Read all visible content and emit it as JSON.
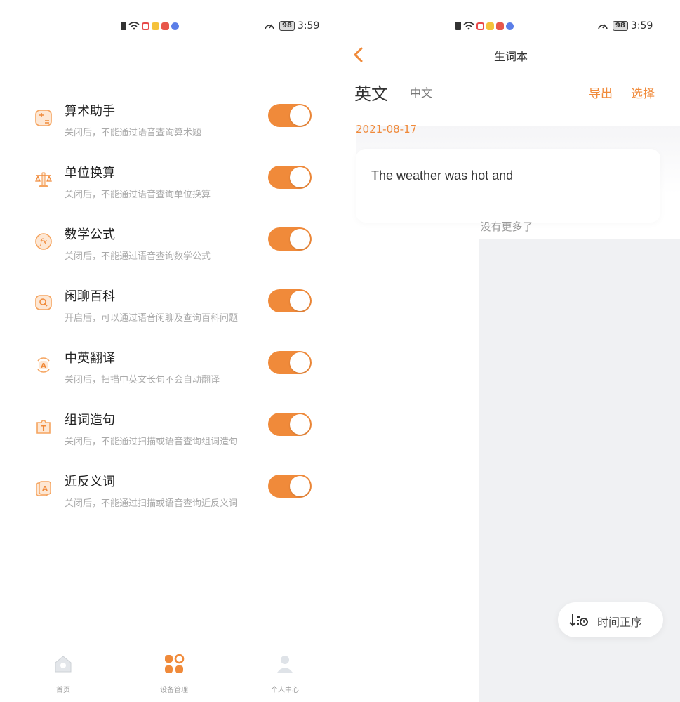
{
  "status": {
    "time": "3:59",
    "battery": "98"
  },
  "settings": [
    {
      "title": "算术助手",
      "desc": "关闭后，不能通过语音查询算术题",
      "enabled": true,
      "icon": "calculator-icon"
    },
    {
      "title": "单位换算",
      "desc": "关闭后，不能通过语音查询单位换算",
      "enabled": true,
      "icon": "scale-icon"
    },
    {
      "title": "数学公式",
      "desc": "关闭后，不能通过语音查询数学公式",
      "enabled": true,
      "icon": "fx-icon"
    },
    {
      "title": "闲聊百科",
      "desc": "开启后，可以通过语音闲聊及查询百科问题",
      "enabled": true,
      "icon": "chat-search-icon"
    },
    {
      "title": "中英翻译",
      "desc": "关闭后，扫描中英文长句不会自动翻译",
      "enabled": true,
      "icon": "translate-icon"
    },
    {
      "title": "组词造句",
      "desc": "关闭后，不能通过扫描或语音查询组词造句",
      "enabled": true,
      "icon": "puzzle-t-icon"
    },
    {
      "title": "近反义词",
      "desc": "关闭后，不能通过扫描或语音查询近反义词",
      "enabled": true,
      "icon": "cards-a-icon"
    }
  ],
  "tabbar": {
    "home": "首页",
    "devices": "设备管理",
    "profile": "个人中心"
  },
  "vocab": {
    "title": "生词本",
    "tab_en": "英文",
    "tab_zh": "中文",
    "export": "导出",
    "select": "选择",
    "date": "2021-08-17",
    "entry": "The weather was hot and",
    "no_more": "没有更多了",
    "sort_label": "时间正序"
  },
  "colors": {
    "accent": "#f08a3a",
    "toggle_on": "#f08a3a"
  }
}
